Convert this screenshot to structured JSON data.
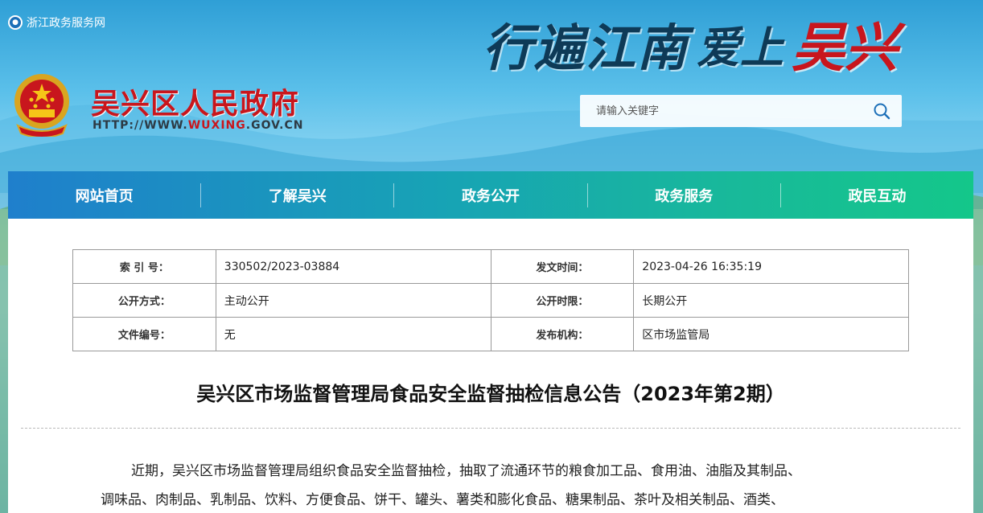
{
  "topbar": {
    "label": "浙江政务服务网"
  },
  "slogan": {
    "part1": "行遍江南",
    "part2": "爱上",
    "part3": "吴兴"
  },
  "site": {
    "title": "吴兴区人民政府",
    "url_prefix": "HTTP://WWW.",
    "url_highlight": "WUXING",
    "url_suffix": ".GOV.CN"
  },
  "search": {
    "placeholder": "请输入关键字"
  },
  "nav": {
    "items": [
      {
        "label": "网站首页"
      },
      {
        "label": "了解吴兴"
      },
      {
        "label": "政务公开"
      },
      {
        "label": "政务服务"
      },
      {
        "label": "政民互动"
      }
    ]
  },
  "meta": {
    "rows": [
      {
        "label1": "索 引 号：",
        "value1": "330502/2023-03884",
        "label2": "发文时间：",
        "value2": "2023-04-26 16:35:19"
      },
      {
        "label1": "公开方式：",
        "value1": "主动公开",
        "label2": "公开时限：",
        "value2": "长期公开"
      },
      {
        "label1": "文件编号：",
        "value1": "无",
        "label2": "发布机构：",
        "value2": "区市场监管局"
      }
    ]
  },
  "article": {
    "title": "吴兴区市场监督管理局食品安全监督抽检信息公告（2023年第2期）",
    "lines": [
      "近期，吴兴区市场监督管理局组织食品安全监督抽检，抽取了流通环节的粮食加工品、食用油、油脂及其制品、",
      "调味品、肉制品、乳制品、饮料、方便食品、饼干、罐头、薯类和膨化食品、糖果制品、茶叶及相关制品、酒类、"
    ]
  },
  "colors": {
    "brand_red": "#c8161d",
    "nav_start": "#1f7fcc",
    "nav_end": "#14c78a"
  }
}
